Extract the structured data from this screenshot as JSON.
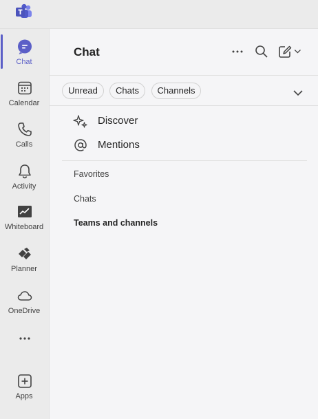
{
  "rail": {
    "items": [
      {
        "label": "Chat",
        "icon": "chat-icon",
        "active": true
      },
      {
        "label": "Calendar",
        "icon": "calendar-icon"
      },
      {
        "label": "Calls",
        "icon": "phone-icon"
      },
      {
        "label": "Activity",
        "icon": "bell-icon"
      },
      {
        "label": "Whiteboard",
        "icon": "whiteboard-icon"
      },
      {
        "label": "Planner",
        "icon": "planner-icon"
      },
      {
        "label": "OneDrive",
        "icon": "cloud-icon"
      },
      {
        "label": "",
        "icon": "more-icon"
      },
      {
        "label": "Apps",
        "icon": "add-apps-icon"
      }
    ]
  },
  "panel": {
    "title": "Chat",
    "filters": [
      "Unread",
      "Chats",
      "Channels"
    ],
    "nav": [
      {
        "label": "Discover",
        "icon": "sparkle-icon"
      },
      {
        "label": "Mentions",
        "icon": "at-sign-icon"
      }
    ],
    "sections": [
      "Favorites",
      "Chats",
      "Teams and channels"
    ]
  },
  "colors": {
    "accent": "#5b5fc7",
    "rail_bg": "#ebebeb",
    "panel_bg": "#f5f5f7"
  }
}
